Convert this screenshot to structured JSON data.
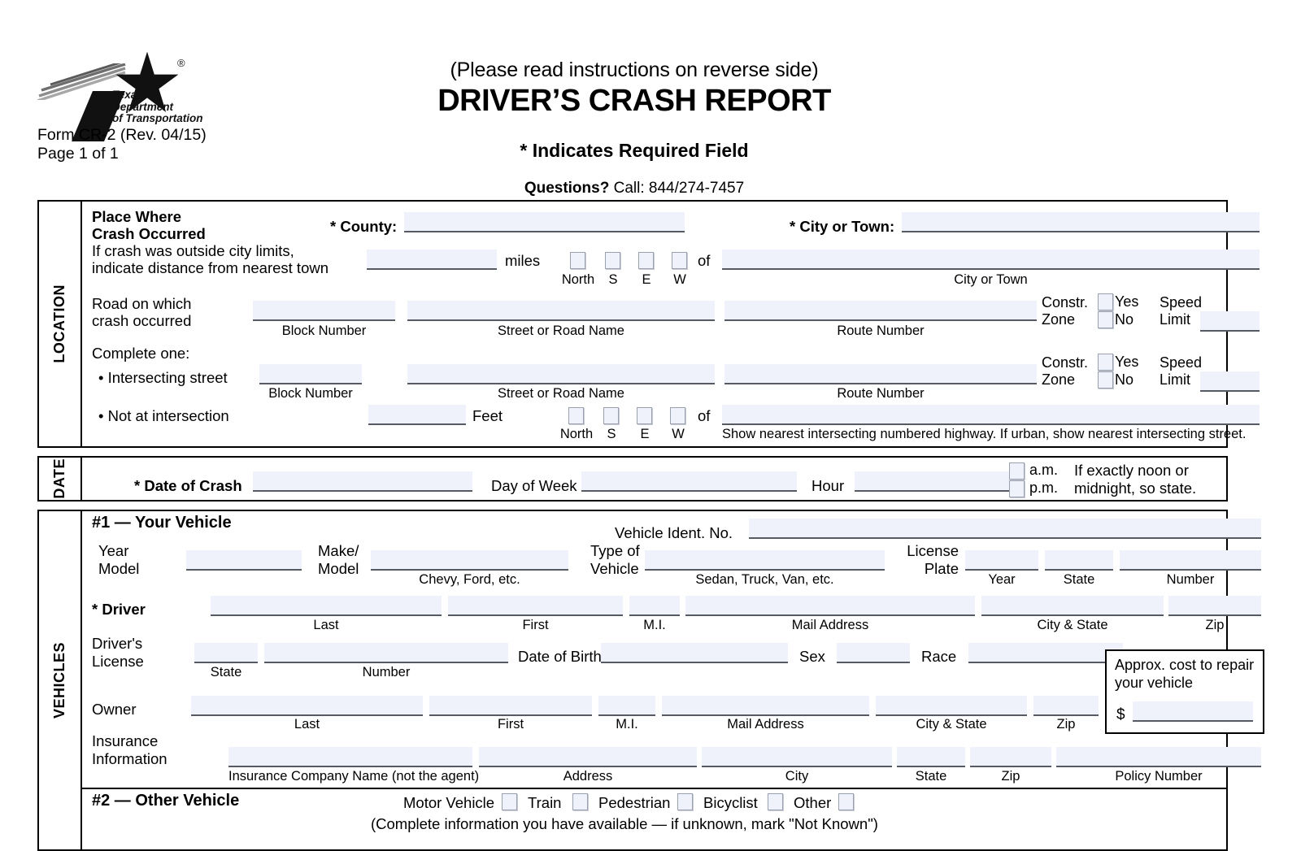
{
  "header": {
    "logo_text_lines": [
      "Texas",
      "Department",
      "of Transportation"
    ],
    "registered_mark": "®",
    "form_id_line1": "Form CR-2 (Rev. 04/15)",
    "form_id_line2": "Page 1 of 1",
    "instruction": "(Please read instructions on reverse side)",
    "title": "DRIVER’S CRASH REPORT",
    "required_note": "* Indicates Required Field",
    "questions_label": "Questions?",
    "questions_text": "Call: 844/274-7457"
  },
  "location": {
    "side_label": "LOCATION",
    "place_line1": "Place Where",
    "place_line2": "Crash Occurred",
    "county_label": "* County:",
    "city_label": "* City or Town:",
    "outside_line1": "If crash was outside city limits,",
    "outside_line2": "indicate distance from nearest town",
    "miles_label": "miles",
    "of_label": "of",
    "city_or_town_sub": "City or Town",
    "dir_north": "North",
    "dir_s": "S",
    "dir_e": "E",
    "dir_w": "W",
    "road_line1": "Road on which",
    "road_line2": "crash occurred",
    "sub_block_number": "Block Number",
    "sub_street": "Street or Road Name",
    "sub_route": "Route Number",
    "constr_line1": "Constr.",
    "constr_line2": "Zone",
    "yes_label": "Yes",
    "no_label": "No",
    "speed_line1": "Speed",
    "speed_line2": "Limit",
    "complete_one": "Complete one:",
    "intersecting_street": "• Intersecting street",
    "not_at_intersection": "• Not at intersection",
    "feet_label": "Feet",
    "note": "Show nearest intersecting numbered highway.  If urban, show nearest intersecting street."
  },
  "date": {
    "side_label": "DATE",
    "date_of_crash": "* Date of Crash",
    "day_of_week": "Day of Week",
    "hour": "Hour",
    "am": "a.m.",
    "pm": "p.m.",
    "note_line1": "If exactly noon or",
    "note_line2": "midnight, so state."
  },
  "vehicles": {
    "side_label": "VEHICLES",
    "v1_title": "#1 — Your Vehicle",
    "vin_label": "Vehicle Ident. No.",
    "year_line1": "Year",
    "year_line2": "Model",
    "make_line1": "Make/",
    "make_line2": "Model",
    "make_sub": "Chevy, Ford, etc.",
    "type_line1": "Type of",
    "type_line2": "Vehicle",
    "type_sub": "Sedan, Truck, Van, etc.",
    "license_line1": "License",
    "license_line2": "Plate",
    "plate_sub_year": "Year",
    "plate_sub_state": "State",
    "plate_sub_number": "Number",
    "driver_label": "* Driver",
    "sub_last": "Last",
    "sub_first": "First",
    "sub_mi": "M.I.",
    "sub_mail_address": "Mail Address",
    "sub_city_state": "City & State",
    "sub_zip": "Zip",
    "dl_line1": "Driver's",
    "dl_line2": "License",
    "dl_sub_state": "State",
    "dl_sub_number": "Number",
    "dob_label": "Date of Birth",
    "sex_label": "Sex",
    "race_label": "Race",
    "cost_line1": "Approx. cost to repair",
    "cost_line2": "your vehicle",
    "cost_dollar": "$",
    "owner_label": "Owner",
    "ins_line1": "Insurance",
    "ins_line2": "Information",
    "ins_sub_company": "Insurance Company Name (not the agent)",
    "ins_sub_address": "Address",
    "ins_sub_city": "City",
    "ins_sub_state": "State",
    "ins_sub_zip": "Zip",
    "ins_sub_policy": "Policy Number",
    "v2_title": "#2 — Other Vehicle",
    "opt_motor_vehicle": "Motor Vehicle",
    "opt_train": "Train",
    "opt_pedestrian": "Pedestrian",
    "opt_bicyclist": "Bicyclist",
    "opt_other": "Other",
    "v2_note": "(Complete information you have available — if unknown, mark \"Not Known\")"
  },
  "colors": {
    "field_fill": "#eff2fb",
    "field_underline": "#555a63",
    "border": "#000000"
  }
}
